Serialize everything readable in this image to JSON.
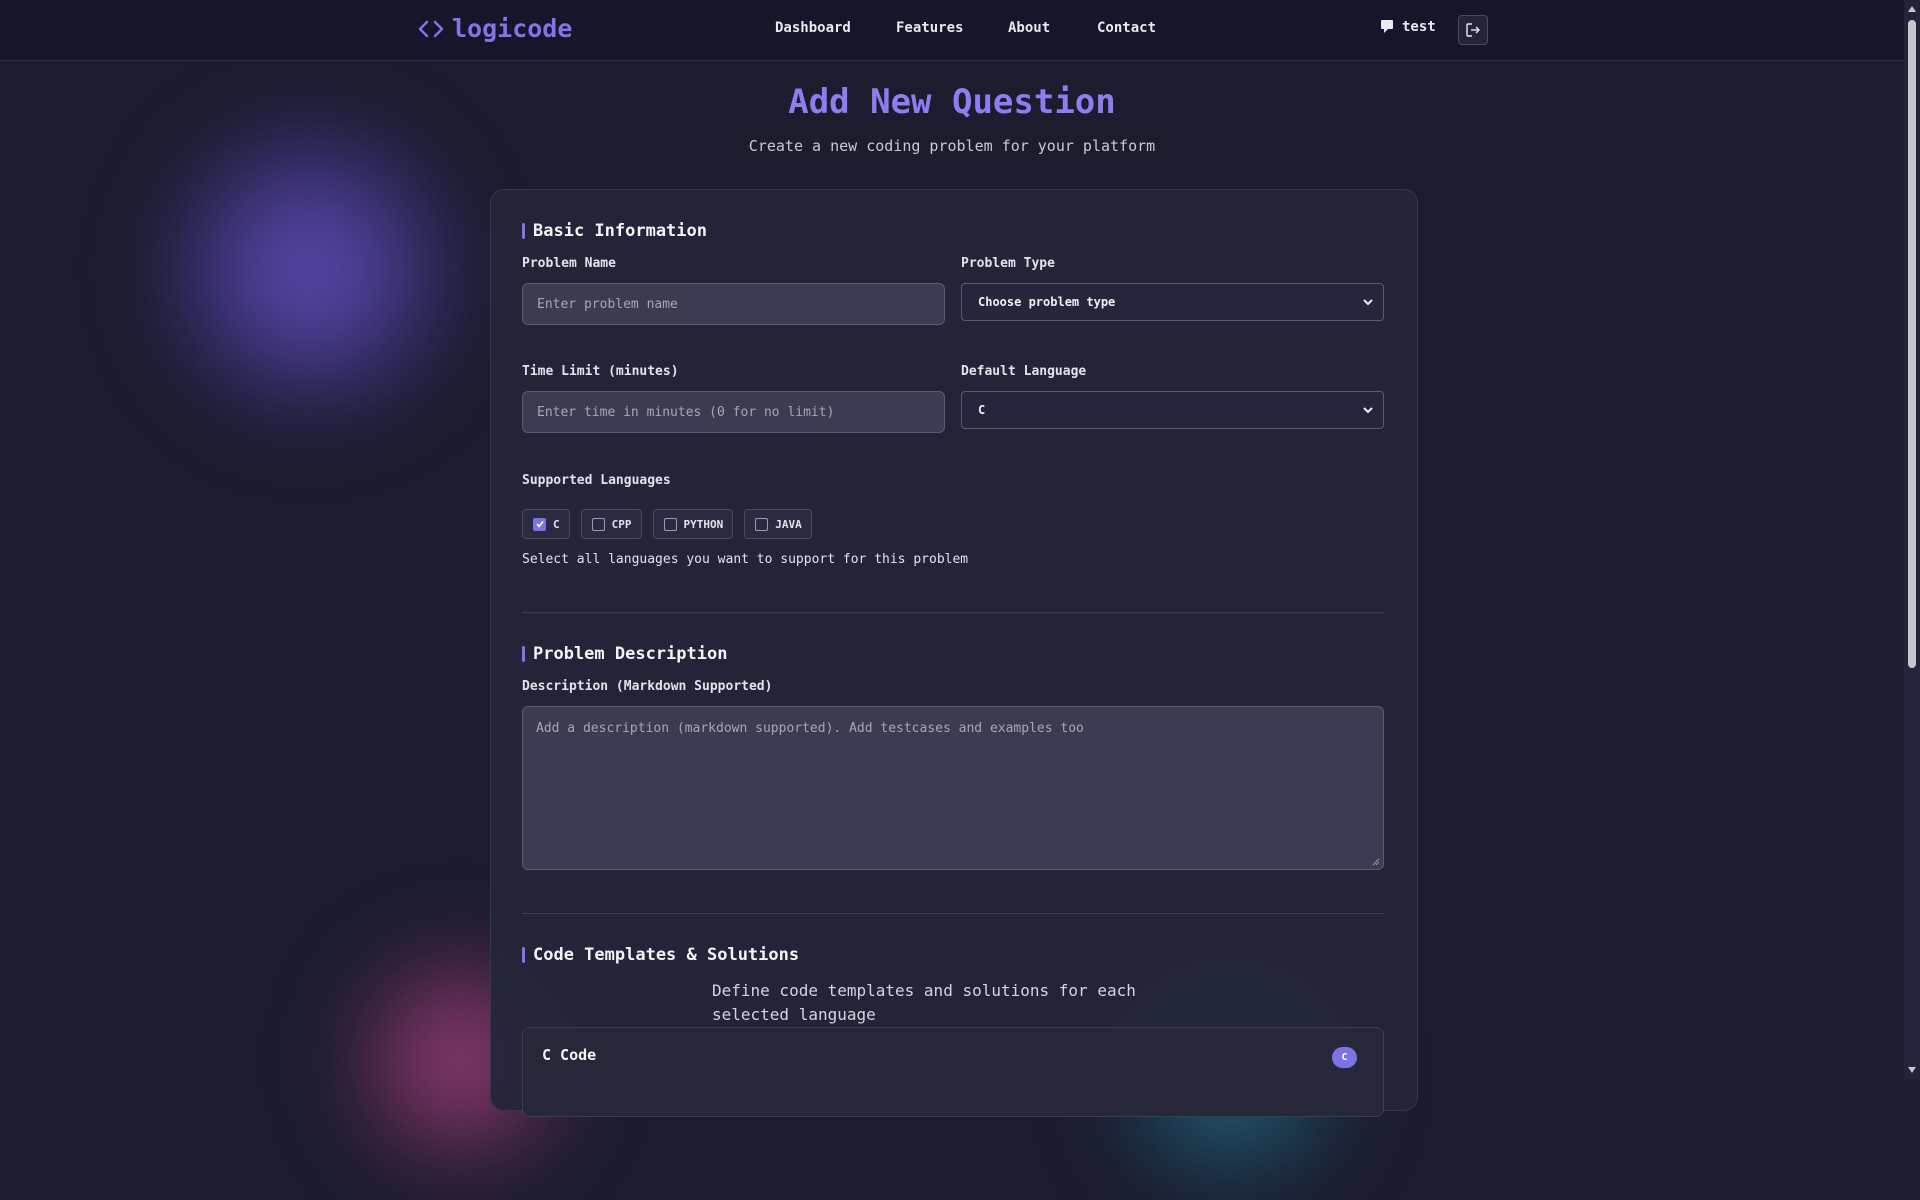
{
  "brand": {
    "name": "logicode",
    "accent": "#7f74e8"
  },
  "nav": {
    "links": [
      "Dashboard",
      "Features",
      "About",
      "Contact"
    ],
    "user_name": "test"
  },
  "header": {
    "title": "Add New Question",
    "subtitle": "Create a new coding problem for your platform"
  },
  "basic_info": {
    "section_title": "Basic Information",
    "problem_name_label": "Problem Name",
    "problem_name_placeholder": "Enter problem name",
    "problem_type_label": "Problem Type",
    "problem_type_value": "Choose problem type",
    "time_limit_label": "Time Limit (minutes)",
    "time_limit_placeholder": "Enter time in minutes (0 for no limit)",
    "default_language_label": "Default Language",
    "default_language_value": "C",
    "supported_languages_label": "Supported Languages",
    "languages": [
      {
        "label": "C",
        "checked": true
      },
      {
        "label": "CPP",
        "checked": false
      },
      {
        "label": "PYTHON",
        "checked": false
      },
      {
        "label": "JAVA",
        "checked": false
      }
    ],
    "languages_helper": "Select all languages you want to support for this problem"
  },
  "description": {
    "section_title": "Problem Description",
    "label": "Description (Markdown Supported)",
    "placeholder": "Add a description (markdown supported). Add testcases and examples too"
  },
  "templates": {
    "section_title": "Code Templates & Solutions",
    "description": "Define code templates and solutions for each selected language",
    "panel_title": "C Code",
    "panel_badge": "C"
  }
}
